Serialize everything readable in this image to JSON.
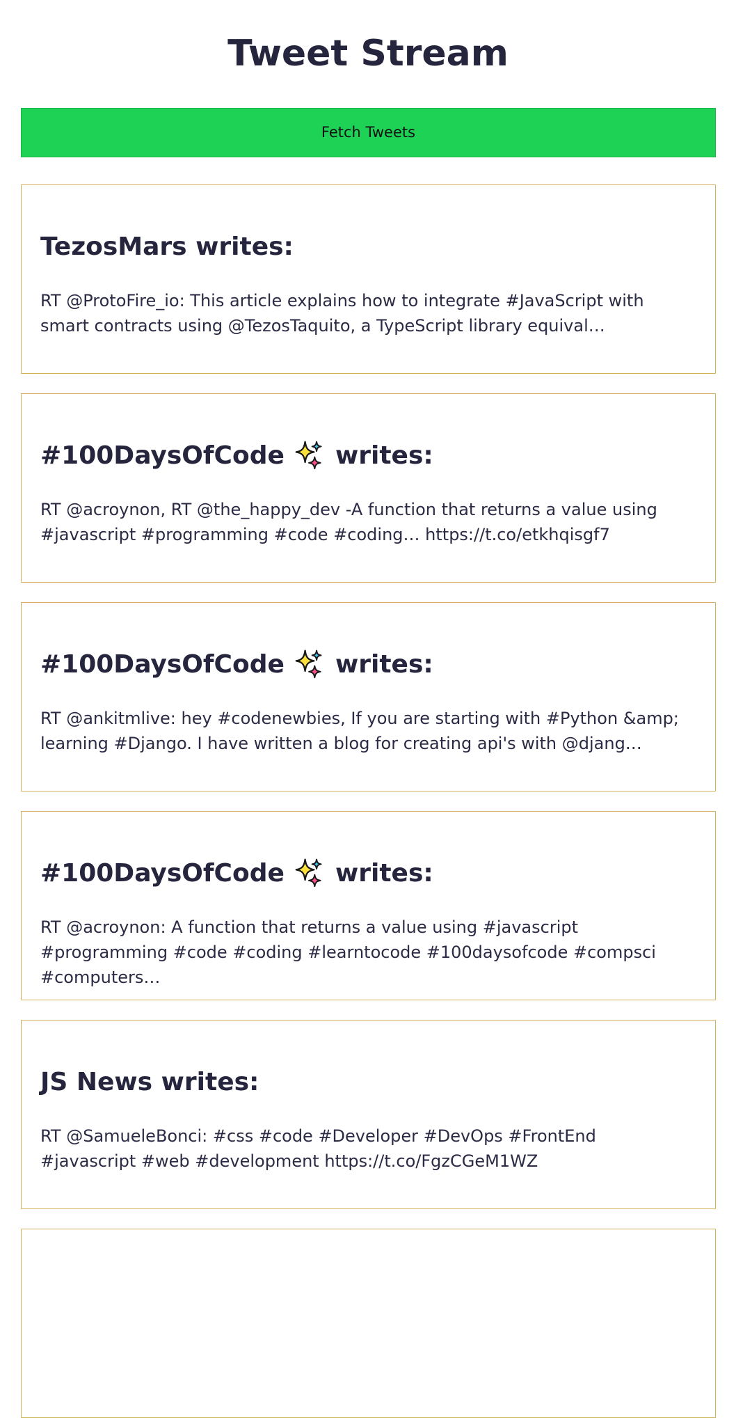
{
  "page": {
    "title": "Tweet Stream"
  },
  "toolbar": {
    "fetch_label": "Fetch Tweets"
  },
  "colors": {
    "button_green": "#1ed256",
    "card_border": "#d4b35d",
    "text_dark": "#25253d"
  },
  "tweets": [
    {
      "author": "TezosMars",
      "author_icon": "",
      "writes": "writes:",
      "text": "RT @ProtoFire_io: This article explains how to integrate #JavaScript with smart contracts using @TezosTaquito, a TypeScript library equival…"
    },
    {
      "author": "#100DaysOfCode",
      "author_icon": "sparkles-icon",
      "writes": "writes:",
      "text": "RT @acroynon, RT @the_happy_dev -A function that returns a value using #javascript #programming #code #coding… https://t.co/etkhqisgf7"
    },
    {
      "author": "#100DaysOfCode",
      "author_icon": "sparkles-icon",
      "writes": "writes:",
      "text": "RT @ankitmlive: hey #codenewbies, If you are starting with #Python &amp; learning #Django. I have written a blog for creating api's with @djang…"
    },
    {
      "author": "#100DaysOfCode",
      "author_icon": "sparkles-icon",
      "writes": "writes:",
      "text": "RT @acroynon: A function that returns a value using #javascript #programming #code #coding #learntocode #100daysofcode #compsci #computers…"
    },
    {
      "author": "JS News",
      "author_icon": "",
      "writes": "writes:",
      "text": "RT @SamueleBonci: #css #code #Developer #DevOps #FrontEnd #javascript #web #development https://t.co/FgzCGeM1WZ"
    }
  ]
}
